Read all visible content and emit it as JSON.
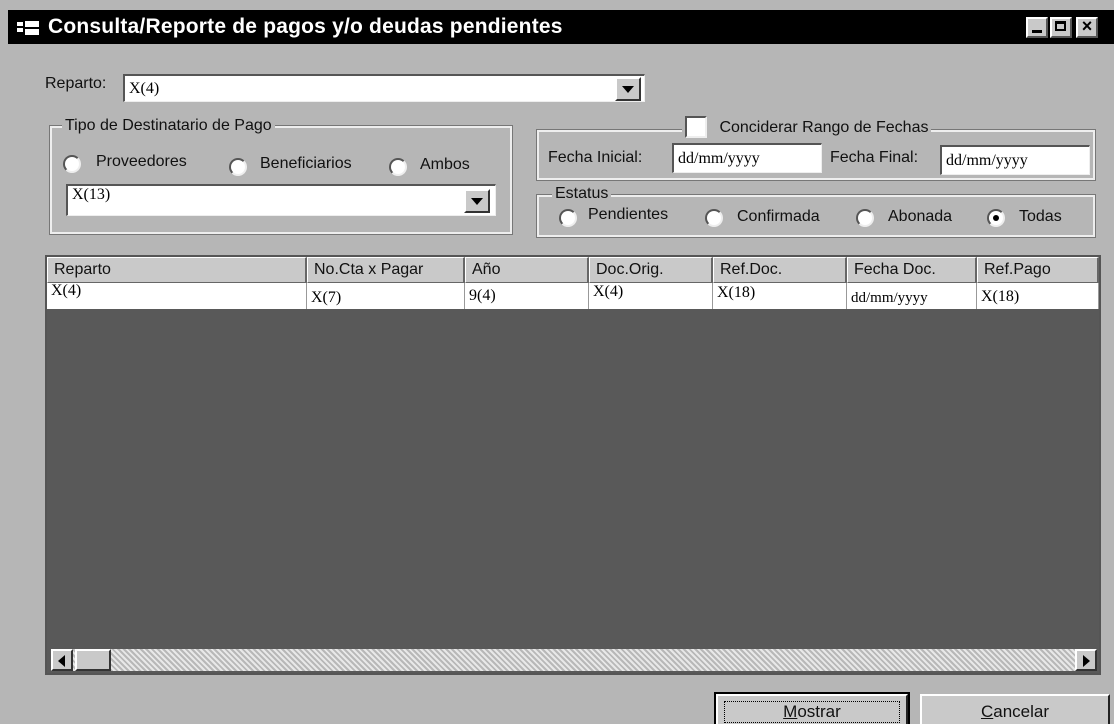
{
  "window": {
    "title": "Consulta/Reporte de pagos y/o  deudas pendientes",
    "icon": "app-icon",
    "controls": [
      "minimize-icon",
      "maximize-icon",
      "close-icon"
    ]
  },
  "reparto": {
    "label": "Reparto:",
    "value": "X(4)"
  },
  "tipo_destinatario": {
    "legend": "Tipo de Destinatario de Pago",
    "options": [
      "Proveedores",
      "Beneficiarios",
      "Ambos"
    ],
    "selected": null,
    "combo_value": "X(13)"
  },
  "rango_fechas": {
    "checkbox_label": "Conciderar Rango de Fechas",
    "checked": false,
    "fecha_inicial_label": "Fecha Inicial:",
    "fecha_inicial_value": "dd/mm/yyyy",
    "fecha_final_label": "Fecha Final:",
    "fecha_final_value": "dd/mm/yyyy"
  },
  "estatus": {
    "legend": "Estatus",
    "options": [
      "Pendientes",
      "Confirmada",
      "Abonada",
      "Todas"
    ],
    "selected": "Todas"
  },
  "grid": {
    "columns": [
      "Reparto",
      "No.Cta x Pagar",
      "Año",
      "Doc.Orig.",
      "Ref.Doc.",
      "Fecha Doc.",
      "Ref.Pago"
    ],
    "rows": [
      [
        "X(4)",
        "X(7)",
        "9(4)",
        "X(4)",
        "X(18)",
        "dd/mm/yyyy",
        "X(18)"
      ]
    ]
  },
  "buttons": {
    "mostrar": {
      "prefix": "",
      "accel": "M",
      "rest": "ostrar"
    },
    "cancelar": {
      "prefix": "",
      "accel": "C",
      "rest": "ancelar"
    }
  }
}
